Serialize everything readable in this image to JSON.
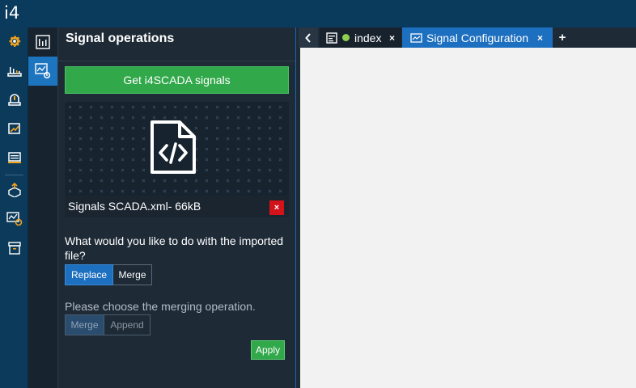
{
  "app": {
    "logo": "i4"
  },
  "panel": {
    "title": "Signal operations",
    "get_signals_label": "Get i4SCADA signals",
    "file_label": "Signals SCADA.xml- 66kB",
    "file_remove_label": "×",
    "question": "What would you like to do with the imported file?",
    "replace_label": "Replace",
    "merge_label": "Merge",
    "choose_label": "Please choose the merging operation.",
    "merge_op_label": "Merge",
    "append_label": "Append",
    "apply_label": "Apply"
  },
  "tabs": {
    "nav_label": "‹",
    "items": [
      {
        "label": "index",
        "close": "×",
        "status_color": "#8fd14f"
      },
      {
        "label": "Signal Configuration",
        "close": "×"
      }
    ],
    "add_label": "+"
  },
  "rail_icons": [
    "gear-icon",
    "plant-icon",
    "alarm-icon",
    "chart-icon",
    "list-icon",
    "package-icon",
    "signal-config-icon",
    "archive-icon"
  ],
  "colors": {
    "accent": "#1d6fbf",
    "success": "#31a84a",
    "danger": "#d3121a",
    "topbar": "#0a3a5c"
  }
}
